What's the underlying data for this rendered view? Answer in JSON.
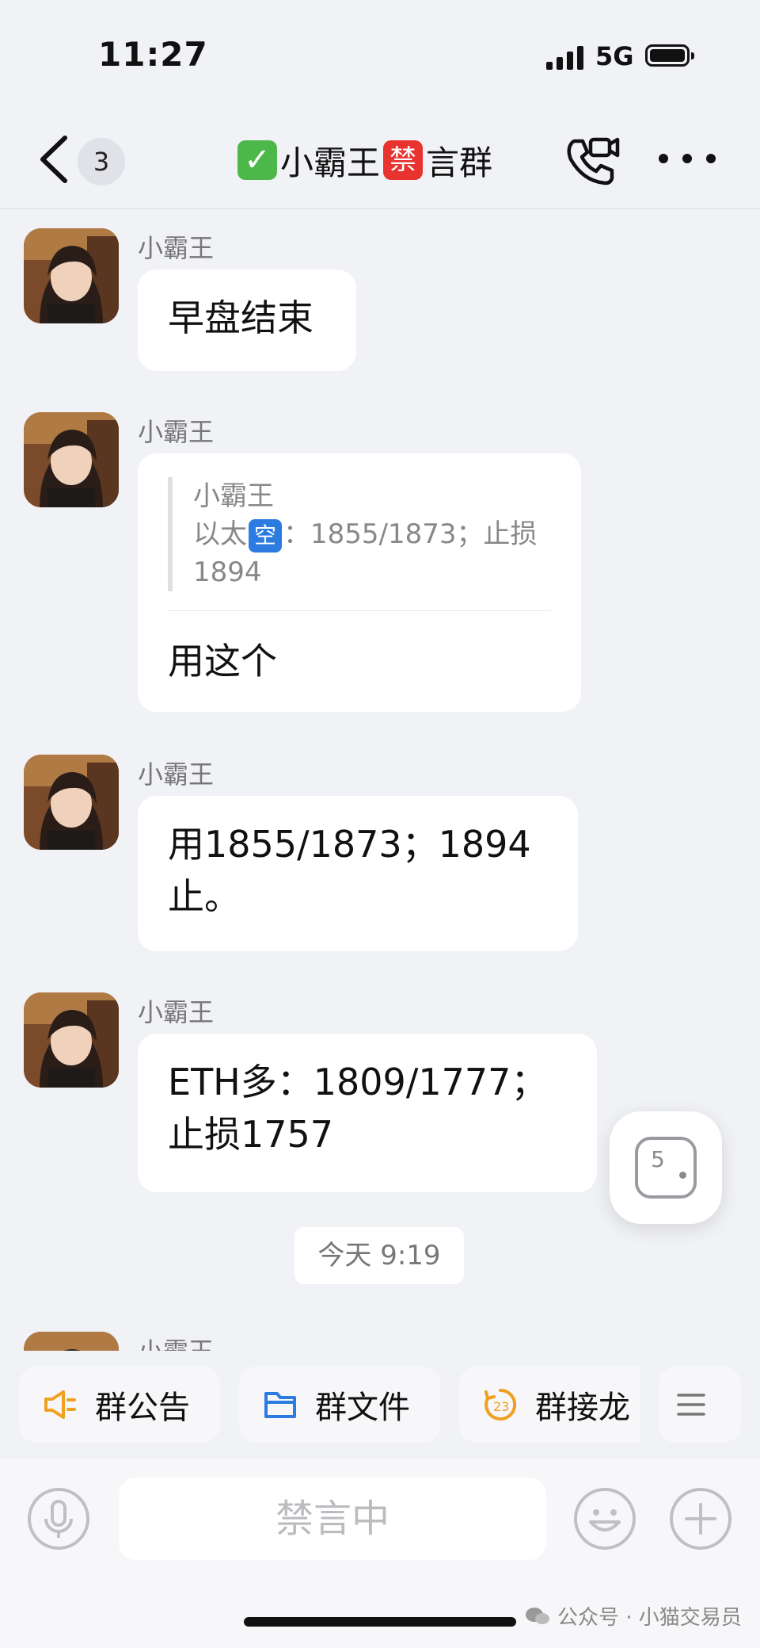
{
  "status_bar": {
    "time": "11:27",
    "network": "5G"
  },
  "header": {
    "unread_count": "3",
    "title_part1": "小霸王",
    "title_ban_char": "禁",
    "title_part2": "言群",
    "title_check_icon": "check-mark-emoji"
  },
  "messages": [
    {
      "sender": "小霸王",
      "text": "早盘结束"
    },
    {
      "sender": "小霸王",
      "quote": {
        "sender": "小霸王",
        "line1_prefix": "以太",
        "line1_emoji": "空",
        "line1_suffix": "：1855/1873；止损",
        "line2": "1894"
      },
      "text": "用这个"
    },
    {
      "sender": "小霸王",
      "text_line1": "用1855/1873；1894",
      "text_line2": "止。"
    },
    {
      "sender": "小霸王",
      "text_line1": "ETH多：1809/1777；",
      "text_line2": "止损1757"
    }
  ],
  "time_divider": "今天 9:19",
  "partial_sender": "小霸王",
  "floating_button": {
    "number": "5"
  },
  "quick_actions": [
    {
      "label": "群公告",
      "icon": "megaphone-icon"
    },
    {
      "label": "群文件",
      "icon": "folder-icon"
    },
    {
      "label": "群接龙",
      "icon": "relay-icon"
    },
    {
      "label": "",
      "icon": "menu-icon"
    }
  ],
  "input": {
    "placeholder": "禁言中"
  },
  "watermark": "公众号 · 小猫交易员",
  "colors": {
    "background": "#f1f2f6",
    "accent_orange": "#f0a020",
    "accent_blue": "#2b7be0"
  }
}
